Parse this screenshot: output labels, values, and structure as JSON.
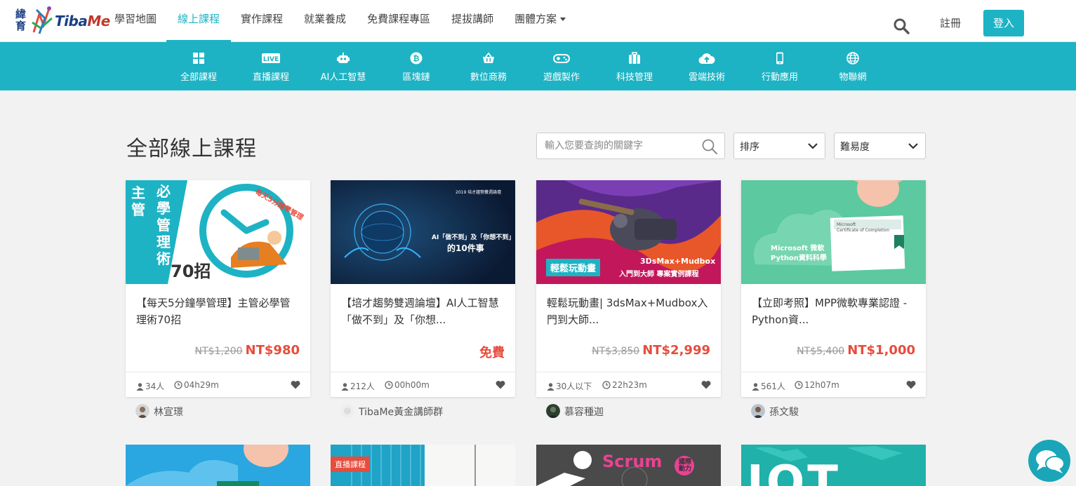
{
  "header": {
    "logo_cn": "緯育",
    "logo_en_a": "Tiba",
    "logo_en_b": "Me",
    "nav": [
      {
        "label": "學習地圖"
      },
      {
        "label": "線上課程"
      },
      {
        "label": "實作課程"
      },
      {
        "label": "就業養成"
      },
      {
        "label": "免費課程專區"
      },
      {
        "label": "提拔講師"
      },
      {
        "label": "團體方案"
      }
    ],
    "active_nav": "線上課程",
    "register": "註冊",
    "login": "登入",
    "accent_color": "#1db3c4"
  },
  "categories": [
    {
      "label": "全部課程",
      "icon": "grid-icon"
    },
    {
      "label": "直播課程",
      "icon": "live-icon"
    },
    {
      "label": "AI人工智慧",
      "icon": "robot-icon"
    },
    {
      "label": "區塊鏈",
      "icon": "bitcoin-icon"
    },
    {
      "label": "數位商務",
      "icon": "basket-icon"
    },
    {
      "label": "遊戲製作",
      "icon": "gamepad-icon"
    },
    {
      "label": "科技管理",
      "icon": "briefcase-icon"
    },
    {
      "label": "雲端技術",
      "icon": "cloud-upload-icon"
    },
    {
      "label": "行動應用",
      "icon": "mobile-icon"
    },
    {
      "label": "物聯網",
      "icon": "globe-icon"
    }
  ],
  "main": {
    "title": "全部線上課程",
    "search_placeholder": "輸入您要查詢的關鍵字",
    "sort_label": "排序",
    "difficulty_label": "難易度"
  },
  "courses": [
    {
      "title": "【每天5分鐘學管理】主管必學管理術70招",
      "old_price": "NT$1,200",
      "price": "NT$980",
      "students": "34人",
      "duration": "04h29m",
      "teacher": "林宣璟",
      "thumb": {
        "t1": "主管",
        "t2": "必學管理術",
        "t3": "70招",
        "t4": "每天5分鐘學管理"
      }
    },
    {
      "title": "【培才趨勢雙週論壇】AI人工智慧「做不到」及「你想...",
      "old_price": "",
      "price": "免費",
      "students": "212人",
      "duration": "00h00m",
      "teacher": "TibaMe黃金講師群",
      "thumb": {
        "t1": "2019 培才趨勢雙週論壇",
        "t2": "AI「做不到」及「你想不到」",
        "t3": "的10件事"
      }
    },
    {
      "title": "輕鬆玩動畫| 3dsMax+Mudbox入門到大師...",
      "old_price": "NT$3,850",
      "price": "NT$2,999",
      "students": "30人以下",
      "duration": "22h23m",
      "teacher": "慕容種迦",
      "thumb": {
        "t1": "輕鬆玩動畫",
        "t2": "3DsMax+Mudbox",
        "t3": "入門到大師 專案實例課程"
      }
    },
    {
      "title": "【立即考照】MPP微軟專業認證 - Python資...",
      "old_price": "NT$5,400",
      "price": "NT$1,000",
      "students": "561人",
      "duration": "12h07m",
      "teacher": "孫文駿",
      "thumb": {
        "t1": "Microsoft 微軟",
        "t2": "Python資料科學",
        "t3": "Microsoft",
        "t4": "Certificate of Completion"
      }
    }
  ],
  "second_row": {
    "live_badge": "直播課程",
    "scrum": "Scrum",
    "scrum_badge": "國際動力",
    "iot": "IOT"
  }
}
